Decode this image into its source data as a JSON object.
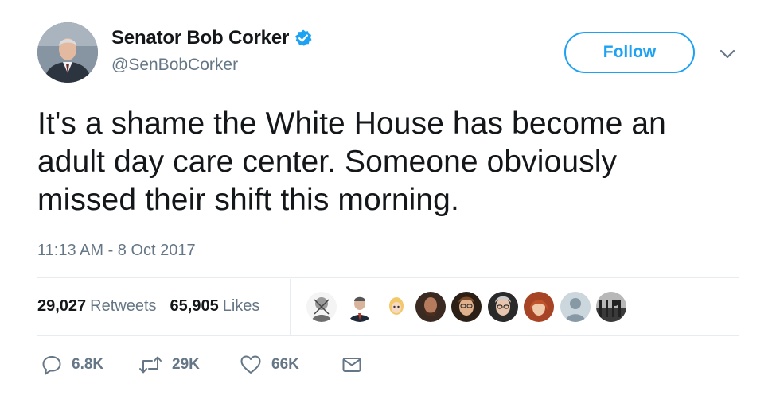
{
  "author": {
    "display_name": "Senator Bob Corker",
    "handle": "@SenBobCorker",
    "verified_icon": "verified-badge-icon"
  },
  "follow_label": "Follow",
  "text": "It's a shame the White House has become an\nadult day care center. Someone obviously\nmissed their shift this morning.",
  "timestamp": "11:13 AM - 8 Oct 2017",
  "stats": {
    "retweets_count": "29,027",
    "retweets_label": "Retweets",
    "likes_count": "65,905",
    "likes_label": "Likes"
  },
  "liker_avatars": [
    "avatar-1",
    "avatar-2",
    "avatar-3",
    "avatar-4",
    "avatar-5",
    "avatar-6",
    "avatar-7",
    "avatar-8",
    "avatar-9"
  ],
  "actions": {
    "reply_count": "6.8K",
    "retweet_count": "29K",
    "like_count": "66K"
  },
  "colors": {
    "accent": "#1da1f2",
    "text": "#14171a",
    "muted": "#657786",
    "divider": "#e6ecf0"
  }
}
